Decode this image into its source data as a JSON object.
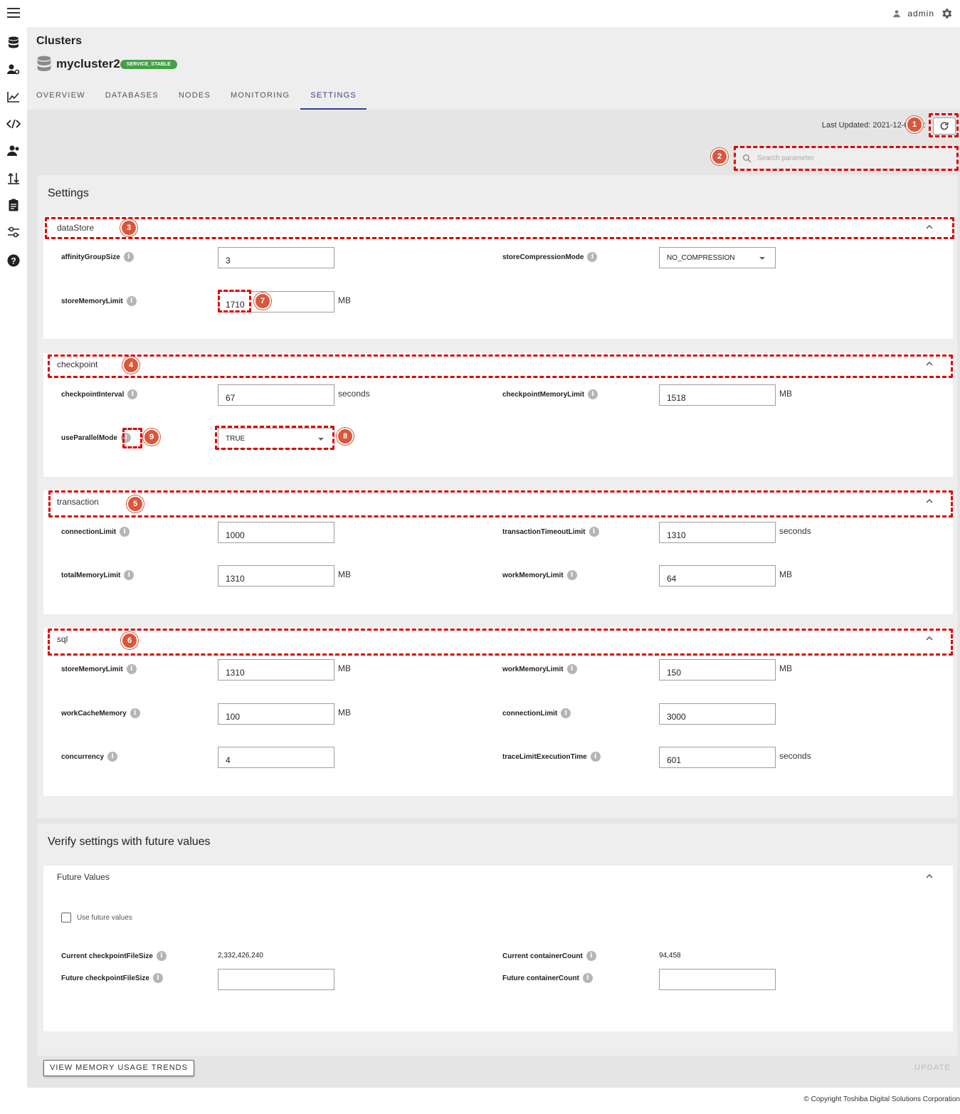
{
  "topbar": {
    "user": "admin"
  },
  "header": {
    "section_title": "Clusters",
    "cluster_name": "mycluster2",
    "status_badge": "SERVICE_STABLE",
    "tabs": [
      "OVERVIEW",
      "DATABASES",
      "NODES",
      "MONITORING",
      "SETTINGS"
    ],
    "active_tab": "SETTINGS"
  },
  "toolbar": {
    "last_updated": "Last Updated: 2021-12-02 16:",
    "search_placeholder": "Search parameter"
  },
  "settings": {
    "title": "Settings",
    "sections": {
      "datastore": {
        "name": "dataStore",
        "affinityGroupSize": {
          "label": "affinityGroupSize",
          "value": "3"
        },
        "storeCompressionMode": {
          "label": "storeCompressionMode",
          "value": "NO_COMPRESSION"
        },
        "storeMemoryLimit": {
          "label": "storeMemoryLimit",
          "value": "1710",
          "unit": "MB"
        }
      },
      "checkpoint": {
        "name": "checkpoint",
        "checkpointInterval": {
          "label": "checkpointInterval",
          "value": "67",
          "unit": "seconds"
        },
        "checkpointMemoryLimit": {
          "label": "checkpointMemoryLimit",
          "value": "1518",
          "unit": "MB"
        },
        "useParallelMode": {
          "label": "useParallelMode",
          "value": "TRUE"
        }
      },
      "transaction": {
        "name": "transaction",
        "connectionLimit": {
          "label": "connectionLimit",
          "value": "1000"
        },
        "transactionTimeoutLimit": {
          "label": "transactionTimeoutLimit",
          "value": "1310",
          "unit": "seconds"
        },
        "totalMemoryLimit": {
          "label": "totalMemoryLimit",
          "value": "1310",
          "unit": "MB"
        },
        "workMemoryLimit": {
          "label": "workMemoryLimit",
          "value": "64",
          "unit": "MB"
        }
      },
      "sql": {
        "name": "sql",
        "storeMemoryLimit": {
          "label": "storeMemoryLimit",
          "value": "1310",
          "unit": "MB"
        },
        "workMemoryLimit": {
          "label": "workMemoryLimit",
          "value": "150",
          "unit": "MB"
        },
        "workCacheMemory": {
          "label": "workCacheMemory",
          "value": "100",
          "unit": "MB"
        },
        "connectionLimit": {
          "label": "connectionLimit",
          "value": "3000"
        },
        "concurrency": {
          "label": "concurrency",
          "value": "4"
        },
        "traceLimitExecutionTime": {
          "label": "traceLimitExecutionTime",
          "value": "601",
          "unit": "seconds"
        }
      }
    }
  },
  "verify": {
    "title": "Verify settings with future values",
    "panel_title": "Future Values",
    "checkbox_label": "Use future values",
    "current_checkpoint_label": "Current checkpointFileSize",
    "current_checkpoint_value": "2,332,426,240",
    "future_checkpoint_label": "Future checkpointFileSize",
    "future_checkpoint_value": "",
    "current_container_label": "Current containerCount",
    "current_container_value": "94,458",
    "future_container_label": "Future containerCount",
    "future_container_value": ""
  },
  "actions": {
    "memory_trends": "VIEW MEMORY USAGE TRENDS",
    "update": "UPDATE"
  },
  "callouts": [
    "1",
    "2",
    "3",
    "4",
    "5",
    "6",
    "7",
    "8",
    "9"
  ],
  "footer": "© Copyright Toshiba Digital Solutions Corporation",
  "colors": {
    "accent": "#3b3f8f",
    "badge": "#43a047",
    "callout": "#d9573b",
    "highlight": "#e00000"
  },
  "icons": [
    "menu-icon",
    "user-icon",
    "gear-icon",
    "database-icon",
    "user-settings-icon",
    "chart-icon",
    "code-icon",
    "users-icon",
    "transfer-icon",
    "clipboard-icon",
    "settings-sliders-icon",
    "help-icon",
    "refresh-icon",
    "search-icon",
    "chevron-up-icon",
    "info-icon"
  ]
}
